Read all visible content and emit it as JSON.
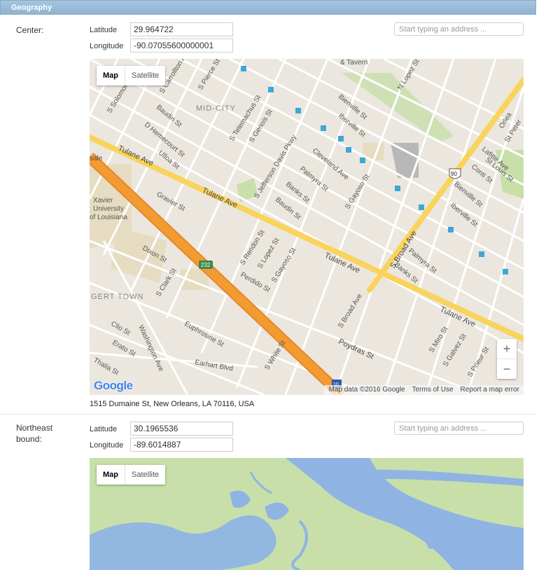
{
  "section": {
    "title": "Geography"
  },
  "center": {
    "label": "Center:",
    "latitude_label": "Latitude",
    "latitude_value": "29.964722",
    "longitude_label": "Longitude",
    "longitude_value": "-90.07055600000001",
    "address_placeholder": "Start typing an address ...",
    "map": {
      "map_button": "Map",
      "satellite_button": "Satellite",
      "zoom_in": "+",
      "zoom_out": "−",
      "google_logo": "Google",
      "map_data": "Map data ©2016 Google",
      "terms": "Terms of Use",
      "report": "Report a map error",
      "labels": {
        "neighborhood_mid_city": "MID-CITY",
        "neighborhood_gert_town": "GERT TOWN",
        "tulane_ave": "Tulane Ave",
        "s_broad_ave": "S Broad Ave",
        "bienville_st": "Bienville St",
        "iberville_st": "Iberville St",
        "cleveland_ave": "Cleveland Ave",
        "palmyra_st": "Palmyra St",
        "banks_st": "Banks St",
        "baudin_st": "Baudin St",
        "gravier_st": "Gravier St",
        "poydras_st": "Poydras St",
        "euphrosine_st": "Euphrosine St",
        "earhart_blvd": "Earhart Blvd",
        "washington_ave": "Washington Ave",
        "dixon_st": "Dixon St",
        "s_clark_st": "S Clark St",
        "s_white_st": "S White St",
        "s_jefferson_davis_pkwy": "S Jefferson Davis Pkwy",
        "s_carrollton_ave": "S Carrollton Ave",
        "s_pierce_st": "S Pierce St",
        "s_solomon": "S Solomon",
        "d_hemecourt_st": "D Hemecourt St",
        "ulloa_st": "Ulloa St",
        "s_telemachus_st": "S Telemachus St",
        "s_genois_st": "S Genois St",
        "s_gayoso_st": "S Gayoso St",
        "s_rendon_st": "S Rendon St",
        "s_lopez_st": "S Lopez St",
        "perdido_st": "Perdido St",
        "clio_st": "Clio St",
        "erato_st": "Erato St",
        "thalia_st": "Thalia St",
        "s_miro_st": "S Miro St",
        "s_galvez_st": "S Galvez St",
        "s_prieur_st": "S Prieur St",
        "n_lopez_st": "N Lopez St",
        "lafitte_ave": "Lafitte Ave",
        "conti_st": "Conti St",
        "st_louis_st": "St Louis St",
        "orleans": "Orlea",
        "st_peter": "St Peter",
        "tavern": "& Tavern",
        "xavier": "Xavier",
        "university": "University",
        "of_louisiana": "of Louisiana",
        "sale": "sale",
        "hwy_232": "232",
        "hwy_90": "90",
        "hwy_10": "10"
      }
    },
    "address_text": "1515 Dumaine St, New Orleans, LA 70116, USA"
  },
  "northeast": {
    "label_line1": "Northeast",
    "label_line2": "bound:",
    "latitude_label": "Latitude",
    "latitude_value": "30.1965536",
    "longitude_label": "Longitude",
    "longitude_value": "-89.6014887",
    "address_placeholder": "Start typing an address ...",
    "map": {
      "map_button": "Map",
      "satellite_button": "Satellite"
    }
  },
  "colors": {
    "header_blue": "#9bbcd8",
    "map_land": "#ebe7de",
    "highway_orange": "#f29b31",
    "arterial_yellow": "#f9d35b",
    "park_green": "#c8dfaa",
    "water_blue": "#8fb4e4"
  }
}
